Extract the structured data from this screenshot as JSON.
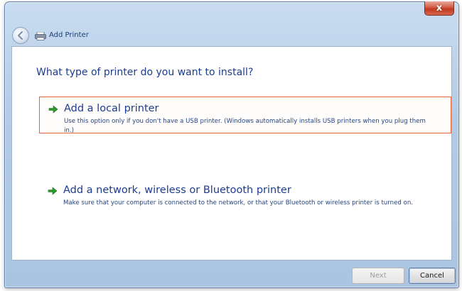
{
  "window": {
    "title": "Add Printer",
    "close_label": "x"
  },
  "icons": {
    "back": "back-arrow-icon",
    "printer": "printer-icon",
    "option_arrow": "green-arrow-icon",
    "close": "close-icon"
  },
  "colors": {
    "heading": "#1c3c8e",
    "selection_border": "#e6643c",
    "arrow_green": "#2e9a2e",
    "close_red": "#c0381f"
  },
  "main": {
    "heading": "What type of printer do you want to install?",
    "options": [
      {
        "title": "Add a local printer",
        "description": "Use this option only if you don't have a USB printer. (Windows automatically installs USB printers when you plug them in.)",
        "selected": true
      },
      {
        "title": "Add a network, wireless or Bluetooth printer",
        "description": "Make sure that your computer is connected to the network, or that your Bluetooth or wireless printer is turned on.",
        "selected": false
      }
    ]
  },
  "footer": {
    "next_label": "Next",
    "cancel_label": "Cancel"
  }
}
